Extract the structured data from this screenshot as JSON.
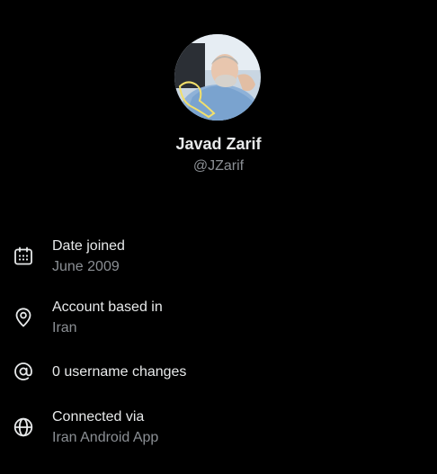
{
  "profile": {
    "display_name": "Javad Zarif",
    "handle": "@JZarif"
  },
  "about": {
    "date_joined": {
      "icon": "calendar-icon",
      "title": "Date joined",
      "value": "June 2009"
    },
    "account_based_in": {
      "icon": "location-pin-icon",
      "title": "Account based in",
      "value": "Iran"
    },
    "username_changes": {
      "icon": "at-sign-icon",
      "title": "0 username changes"
    },
    "connected_via": {
      "icon": "globe-icon",
      "title": "Connected via",
      "value": "Iran Android App"
    }
  },
  "colors": {
    "background": "#000000",
    "primary_text": "#e7e9ea",
    "secondary_text": "#8b8f94"
  }
}
